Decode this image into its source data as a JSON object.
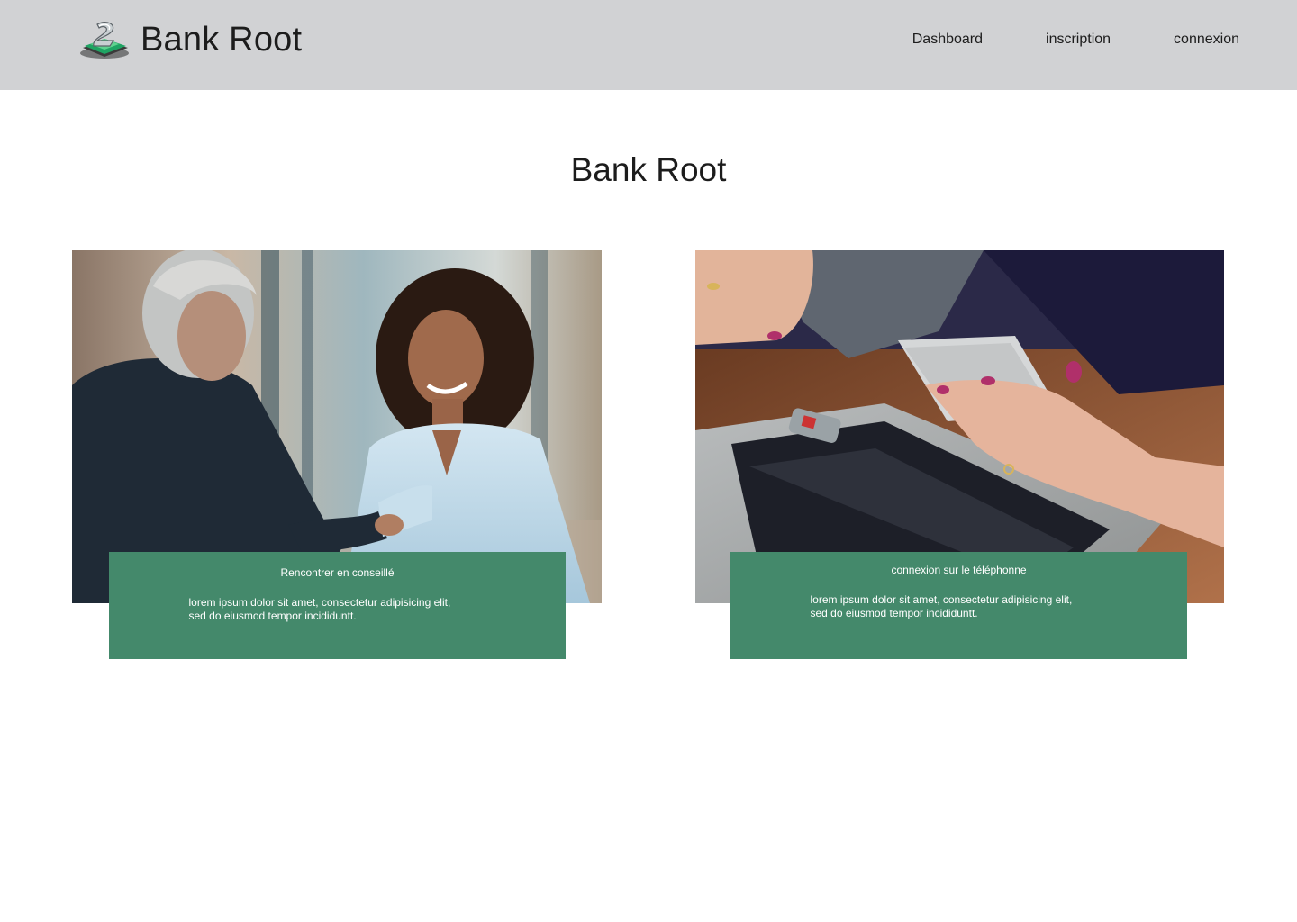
{
  "header": {
    "brand_name": "Bank Root",
    "logo": "bank-root-logo-icon",
    "nav": [
      {
        "label": "Dashboard"
      },
      {
        "label": "inscription"
      },
      {
        "label": "connexion"
      }
    ]
  },
  "main": {
    "title": "Bank Root",
    "cards": [
      {
        "image": "handshake-meeting-photo",
        "title": "Rencontrer en conseillé",
        "text": "lorem ipsum dolor sit amet, consectetur adipisicing elit,\n sed do eiusmod tempor incididuntt."
      },
      {
        "image": "phone-and-laptop-photo",
        "title": "connexion sur le téléphonne",
        "text": "lorem ipsum dolor sit amet, consectetur adipisicing elit,\n sed do eiusmod tempor incididuntt."
      }
    ]
  },
  "colors": {
    "header_bg": "#d1d2d4",
    "caption_bg": "#44896b",
    "brand_green": "#1fa463"
  }
}
